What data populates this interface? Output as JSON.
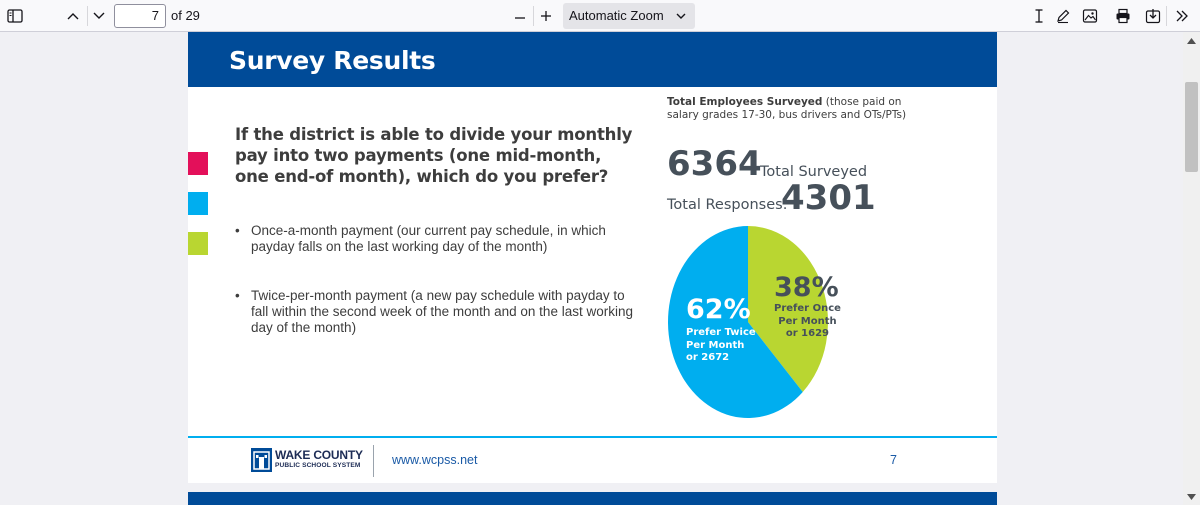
{
  "toolbar": {
    "page_number": "7",
    "page_count": "of 29",
    "zoom": "Automatic Zoom"
  },
  "slide": {
    "title": "Survey Results",
    "question": "If the district is able to divide your monthly pay into two payments (one mid-month, one end-of month), which do you prefer?",
    "bullets": [
      "Once-a-month payment (our current pay schedule, in which payday falls on the last working day of the month)",
      "Twice-per-month payment (a new pay schedule with payday to fall within the second week of the month and on the last working day of the month)"
    ],
    "swatch_colors": [
      "#e3105a",
      "#00aeef",
      "#b9d631"
    ],
    "employees_note_bold": "Total Employees Surveyed",
    "employees_note_rest": " (those paid on salary grades 17-30, bus drivers and OTs/PTs)",
    "total_surveyed_value": "6364",
    "total_surveyed_label": "Total Surveyed",
    "total_responses_label": "Total Responses:",
    "total_responses_value": "4301",
    "footer_logo_line1": "WAKE COUNTY",
    "footer_logo_line2": "PUBLIC SCHOOL SYSTEM",
    "footer_url": "www.wcpss.net",
    "footer_page": "7"
  },
  "chart_data": {
    "type": "pie",
    "slices": [
      {
        "label": "Prefer Twice Per Month or 2672",
        "percent_text": "62%",
        "value": 62,
        "count": 2672,
        "color": "#00aeef"
      },
      {
        "label": "Prefer Once Per Month or 1629",
        "percent_text": "38%",
        "value": 38,
        "count": 1629,
        "color": "#b9d631"
      }
    ]
  },
  "pie_labels": {
    "twice_pct": "62%",
    "twice_l1": "Prefer Twice",
    "twice_l2": "Per Month",
    "twice_l3": "or 2672",
    "once_pct": "38%",
    "once_l1": "Prefer Once",
    "once_l2": "Per Month",
    "once_l3": "or 1629"
  }
}
